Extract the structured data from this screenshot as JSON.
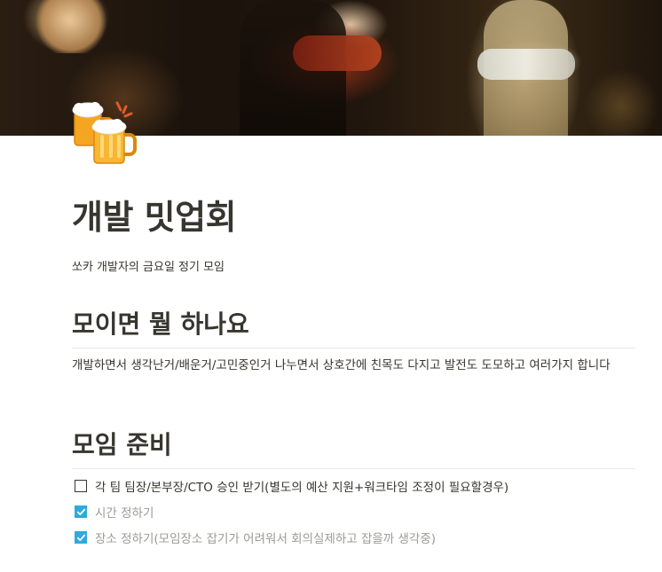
{
  "cover": {
    "icon": "beer-mugs-icon"
  },
  "page": {
    "title": "개발 밋업회",
    "description": "쏘카 개발자의 금요일 정기 모임"
  },
  "sections": [
    {
      "heading": "모이면 뭘 하나요",
      "body": "개발하면서 생각난거/배운거/고민중인거 나누면서 상호간에 친목도 다지고 발전도 도모하고 여러가지 합니다"
    },
    {
      "heading": "모임 준비",
      "todos": [
        {
          "text": "각 팀 팀장/본부장/CTO 승인 받기(별도의 예산 지원+워크타임 조정이 필요할경우)",
          "checked": false
        },
        {
          "text": "시간 정하기",
          "checked": true
        },
        {
          "text": "장소 정하기(모임장소 잡기가 어려워서 회의실제하고 잡을까 생각중)",
          "checked": true
        }
      ]
    }
  ],
  "colors": {
    "text": "#37352f",
    "muted": "#9b9a97",
    "checkbox_checked": "#2eaadc",
    "divider": "#e9e9e7"
  }
}
